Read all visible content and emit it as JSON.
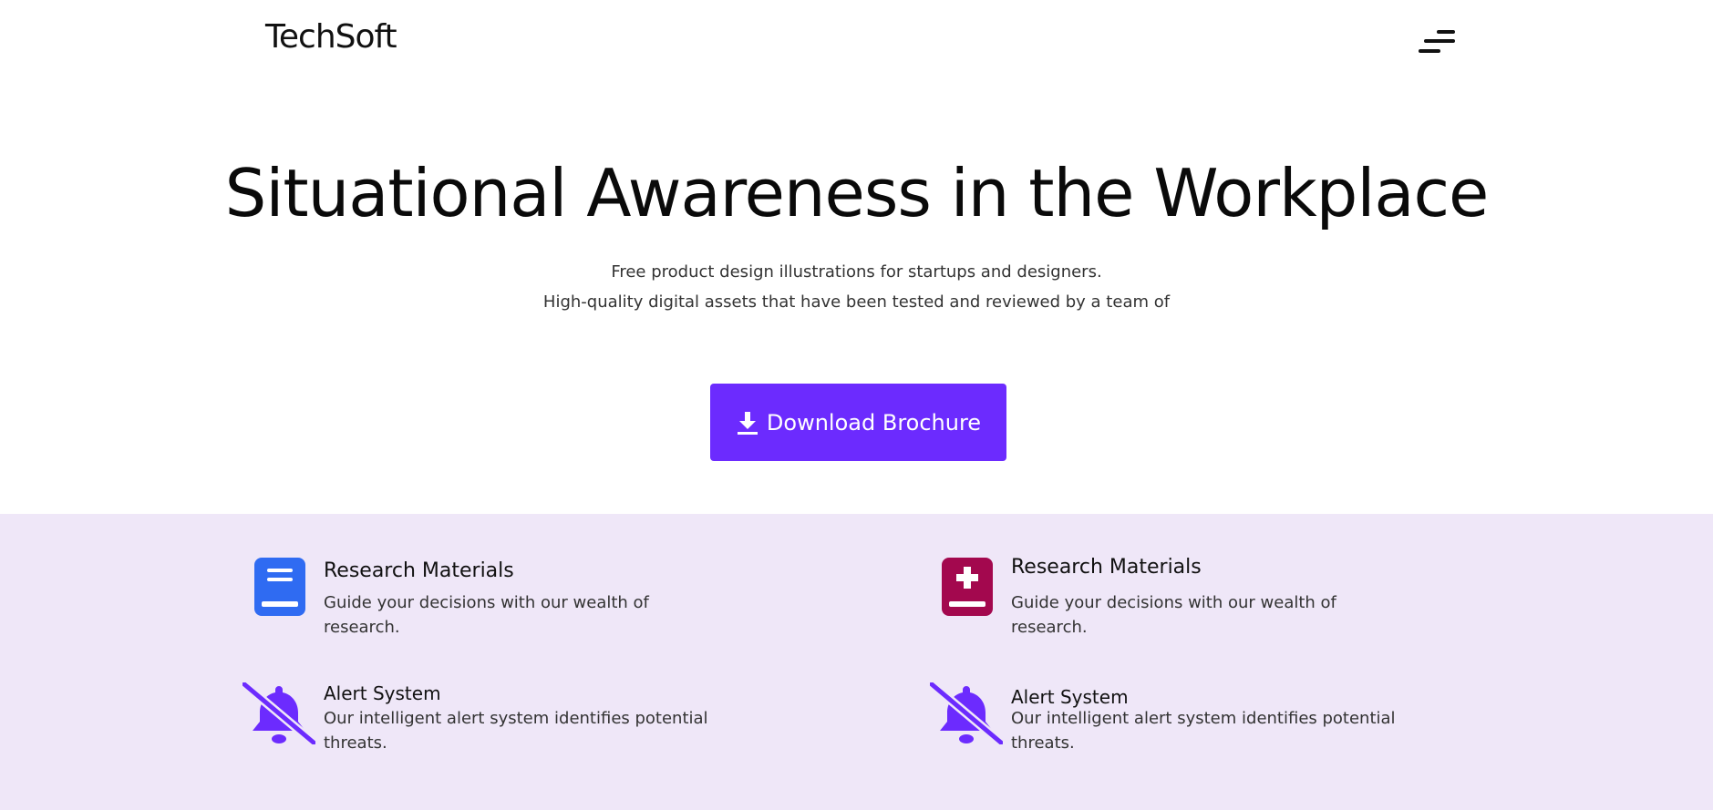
{
  "header": {
    "logo": "TechSoft",
    "menu_icon": "menu-icon"
  },
  "hero": {
    "title": "Situational Awareness in the Workplace",
    "subtitle_line1": "Free product design illustrations for startups and designers.",
    "subtitle_line2": "High-quality digital assets that have been tested and reviewed by a team of",
    "cta_label": "Download Brochure",
    "cta_icon": "download-icon",
    "cta_color": "#6c2bfe"
  },
  "features": {
    "background": "#efe7f8",
    "items": [
      {
        "title": "Research Materials",
        "desc": "Guide your decisions with our wealth of research.",
        "icon": "book-icon",
        "icon_color": "#2f6bf2"
      },
      {
        "title": "Research Materials",
        "desc": "Guide your decisions with our wealth of research.",
        "icon": "medical-book-icon",
        "icon_color": "#a3084e"
      },
      {
        "title": "Alert System",
        "desc": "Our intelligent alert system identifies potential threats.",
        "icon": "bell-slash-icon",
        "icon_color": "#6c2bfe"
      },
      {
        "title": "Alert System",
        "desc": "Our intelligent alert system identifies potential threats.",
        "icon": "bell-slash-icon",
        "icon_color": "#6c2bfe"
      }
    ]
  }
}
